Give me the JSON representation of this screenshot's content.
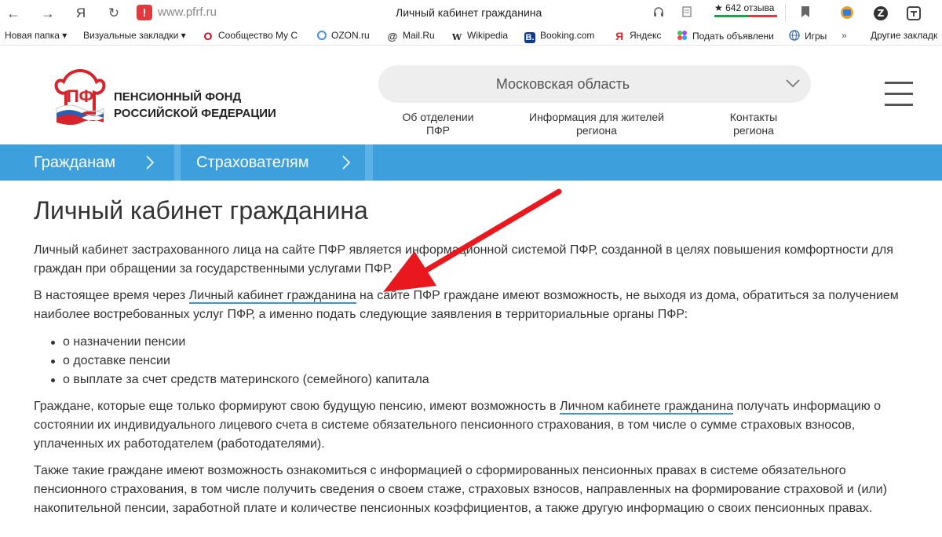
{
  "browser": {
    "url": "www.pfrf.ru",
    "tab_title": "Личный кабинет гражданина",
    "rating_text": "642 отзыва",
    "yandex_glyph": "Я"
  },
  "bookmarks": [
    {
      "label": "Новая папка ▾",
      "icon": "none"
    },
    {
      "label": "Визуальные закладки ▾",
      "icon": "none"
    },
    {
      "label": "Сообщество My C",
      "icon": "opera-icon"
    },
    {
      "label": "OZON.ru",
      "icon": "ozon-icon"
    },
    {
      "label": "Mail.Ru",
      "icon": "mailru-icon"
    },
    {
      "label": "Wikipedia",
      "icon": "wikipedia-icon"
    },
    {
      "label": "Booking.com",
      "icon": "booking-icon"
    },
    {
      "label": "Яндекс",
      "icon": "yandex-icon"
    },
    {
      "label": "Подать объявлени",
      "icon": "avito-icon"
    },
    {
      "label": "Игры",
      "icon": "globe-icon"
    },
    {
      "label": "Другие закладк",
      "icon": "none"
    }
  ],
  "header": {
    "logo_line1": "ПЕНСИОННЫЙ ФОНД",
    "logo_line2": "РОССИЙСКОЙ ФЕДЕРАЦИИ",
    "region": "Московская область",
    "links": [
      {
        "line1": "Об отделении",
        "line2": "ПФР"
      },
      {
        "line1": "Информация для жителей",
        "line2": "региона"
      },
      {
        "line1": "Контакты",
        "line2": "региона"
      }
    ]
  },
  "nav": {
    "items": [
      "Гражданам",
      "Страхователям"
    ]
  },
  "content": {
    "title": "Личный кабинет гражданина",
    "p1": "Личный кабинет застрахованного лица на сайте ПФР является информационной системой ПФР, созданной в целях повышения комфортности для граждан при обращении за государственными услугами ПФР.",
    "p2_before": "В настоящее время через ",
    "p2_link": "Личный кабинет гражданина",
    "p2_after": " на сайте ПФР граждане имеют возможность, не выходя из дома, обратиться за получением наиболее востребованных услуг ПФР, а именно подать следующие заявления в территориальные органы ПФР:",
    "list": [
      "о назначении пенсии",
      "о доставке пенсии",
      "о выплате за счет средств материнского (семейного) капитала"
    ],
    "p3_before": "Граждане, которые еще только формируют свою будущую пенсию, имеют возможность в ",
    "p3_link": "Личном кабинете гражданина",
    "p3_after": " получать информацию о состоянии их индивидуального лицевого счета в системе обязательного пенсионного страхования, в том числе о сумме страховых взносов, уплаченных их работодателем (работодателями).",
    "p4": "Также такие граждане имеют возможность ознакомиться с информацией о сформированных пенсионных правах в системе обязательного пенсионного страхования, в том числе получить сведения о своем стаже, страховых взносов, направленных на формирование страховой и (или) накопительной пенсии, заработной плате и количестве пенсионных коэффициентов, а также другую информацию о своих пенсионных правах."
  },
  "colors": {
    "nav_blue": "#3da0dc",
    "link_underline": "#3d93d6",
    "annotation_arrow": "#e8181e"
  }
}
